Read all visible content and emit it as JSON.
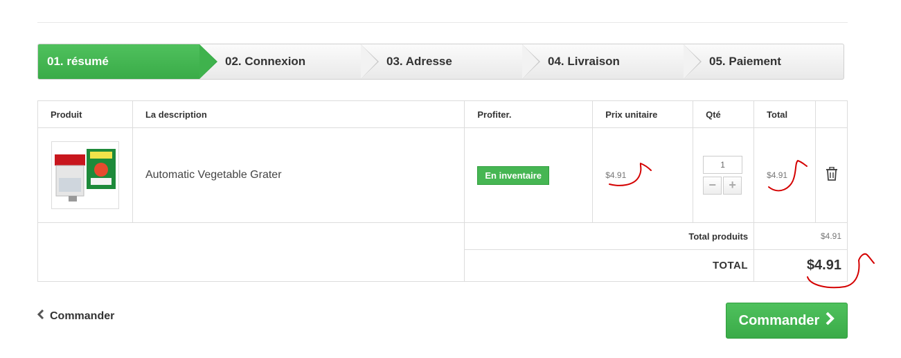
{
  "steps": [
    {
      "label": "01. résumé",
      "active": true
    },
    {
      "label": "02. Connexion",
      "active": false
    },
    {
      "label": "03. Adresse",
      "active": false
    },
    {
      "label": "04. Livraison",
      "active": false
    },
    {
      "label": "05. Paiement",
      "active": false
    }
  ],
  "table": {
    "headers": {
      "product": "Produit",
      "description": "La description",
      "availability": "Profiter.",
      "unit_price": "Prix unitaire",
      "qty": "Qté",
      "total": "Total"
    },
    "row": {
      "description": "Automatic Vegetable Grater",
      "availability": "En inventaire",
      "unit_price": "$4.91",
      "qty": "1",
      "total": "$4.91"
    },
    "summary": {
      "products_label": "Total produits",
      "products_value": "$4.91",
      "total_label": "TOTAL",
      "total_value": "$4.91"
    }
  },
  "nav": {
    "back_label": "Commander",
    "order_label": "Commander"
  },
  "colors": {
    "accent_green": "#3fb24d",
    "annotation_red": "#d40000"
  },
  "icons": {
    "trash": "trash-icon",
    "chevron_left": "chevron-left-icon",
    "chevron_right": "chevron-right-icon",
    "minus": "minus-icon",
    "plus": "plus-icon"
  }
}
